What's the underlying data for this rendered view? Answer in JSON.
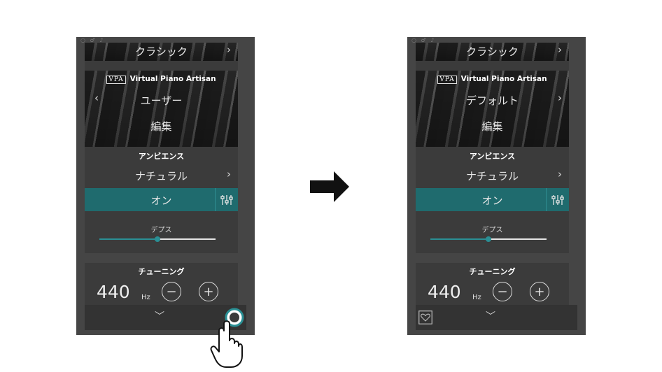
{
  "before": {
    "panel": {
      "genre": "クラシック",
      "vpa_logo": "VPA",
      "vpa_title": "Virtual Piano Artisan",
      "preset": "ユーザー",
      "edit": "編集"
    },
    "ambience": {
      "title": "アンビエンス",
      "type": "ナチュラル",
      "toggle": "オン",
      "depth_label": "デプス",
      "depth_level": 0.5
    },
    "tuning": {
      "title": "チューニング",
      "value": "440",
      "unit": "Hz"
    }
  },
  "after": {
    "panel": {
      "genre": "クラシック",
      "vpa_logo": "VPA",
      "vpa_title": "Virtual Piano Artisan",
      "preset": "デフォルト",
      "edit": "編集"
    },
    "ambience": {
      "title": "アンビエンス",
      "type": "ナチュラル",
      "toggle": "オン",
      "depth_label": "デプス",
      "depth_level": 0.5
    },
    "tuning": {
      "title": "チューニング",
      "value": "440",
      "unit": "Hz"
    }
  },
  "glyphs": {
    "chevron_right": "›",
    "chevron_left": "‹",
    "chevron_down": "﹀",
    "minus": "−",
    "plus": "+"
  },
  "icons": {
    "equalizer": "equalizer-icon",
    "heart": "heart-icon",
    "hand_pointer": "hand-pointer-icon",
    "arrow": "arrow-right-icon"
  },
  "colors": {
    "phone_bg": "#454545",
    "panel_bg": "#3b3b3b",
    "accent": "#1f6b6e",
    "slider": "#2a8f94"
  }
}
